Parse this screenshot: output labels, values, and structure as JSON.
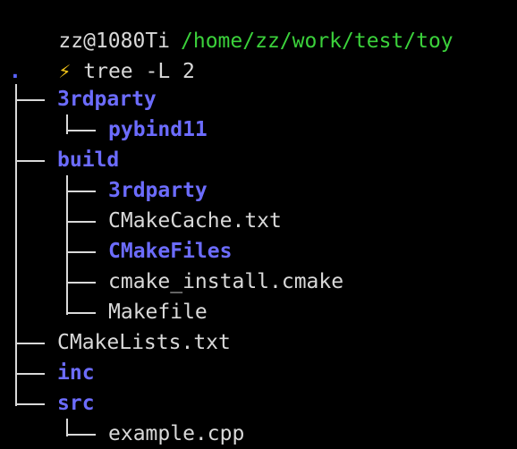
{
  "prompt": {
    "user_host": "zz@1080Ti",
    "cwd": "/home/zz/work/test/toy",
    "symbol": "⚡",
    "command": "tree -L 2"
  },
  "tree": {
    "root": ".",
    "entries": [
      {
        "name": "3rdparty",
        "type": "directory"
      },
      {
        "name": "pybind11",
        "type": "directory"
      },
      {
        "name": "build",
        "type": "directory"
      },
      {
        "name": "3rdparty",
        "type": "directory"
      },
      {
        "name": "CMakeCache.txt",
        "type": "file"
      },
      {
        "name": "CMakeFiles",
        "type": "directory"
      },
      {
        "name": "cmake_install.cmake",
        "type": "file"
      },
      {
        "name": "Makefile",
        "type": "file"
      },
      {
        "name": "CMakeLists.txt",
        "type": "file"
      },
      {
        "name": "inc",
        "type": "directory"
      },
      {
        "name": "src",
        "type": "directory"
      },
      {
        "name": "example.cpp",
        "type": "file"
      }
    ]
  },
  "colors": {
    "background": "#000000",
    "text": "#d9d9d9",
    "path": "#3bd13b",
    "bolt": "#f2c318",
    "directory": "#6c6cff"
  }
}
